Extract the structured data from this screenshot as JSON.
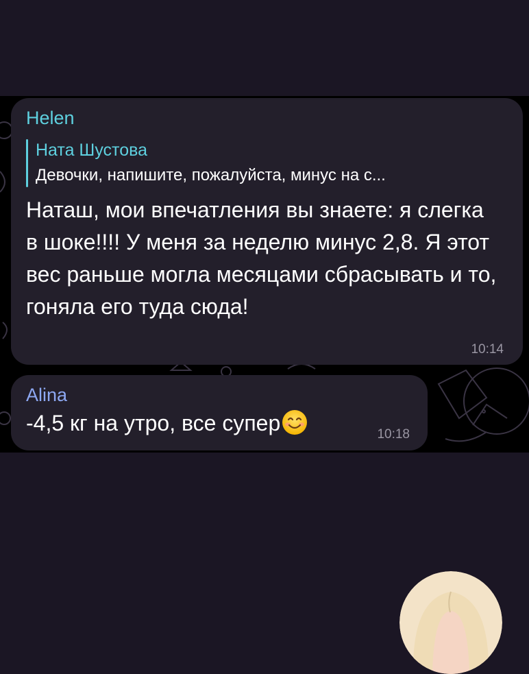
{
  "messages": [
    {
      "sender": "Helen",
      "reply": {
        "name": "Ната Шустова",
        "text": "Девочки, напишите, пожалуйста, минус на с..."
      },
      "text": "Наташ, мои впечатления вы знаете: я слегка в шоке!!!! У меня за неделю минус 2,8. Я этот вес раньше могла месяцами сбрасывать и то, гоняла его туда сюда!",
      "time": "10:14"
    },
    {
      "sender": "Alina",
      "text": "-4,5 кг на утро, все супер",
      "emoji": "smiling-face-emoji",
      "time": "10:18"
    }
  ],
  "colors": {
    "background": "#1b1624",
    "chat_background": "#000000",
    "bubble": "#231f2b",
    "helen_name": "#5ed0df",
    "alina_name": "#8da8f2",
    "time": "#9a96a3"
  }
}
